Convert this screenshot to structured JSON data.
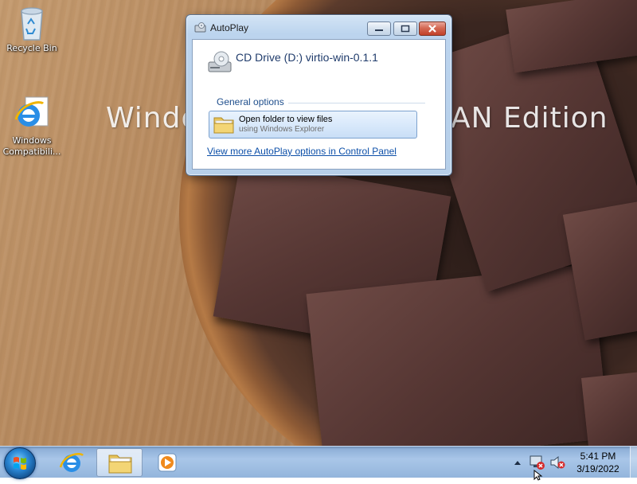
{
  "desktop": {
    "watermark": "Windows 7 ULTIMATE CRAPSTAN Edition",
    "watermark_left": "Windo",
    "watermark_right": "AN Edition",
    "icons": [
      {
        "label": "Recycle Bin",
        "icon": "recycle-bin-icon"
      },
      {
        "label": "Windows Compatibili...",
        "icon": "internet-explorer-icon"
      }
    ]
  },
  "autoplay": {
    "title": "AutoPlay",
    "drive_label": "CD Drive (D:) virtio-win-0.1.1",
    "section_label": "General options",
    "option": {
      "main": "Open folder to view files",
      "sub": "using Windows Explorer"
    },
    "more_link": "View more AutoPlay options in Control Panel"
  },
  "taskbar": {
    "buttons": [
      {
        "icon": "internet-explorer-icon"
      },
      {
        "icon": "windows-explorer-icon"
      },
      {
        "icon": "windows-media-player-icon"
      }
    ],
    "clock": {
      "time": "5:41 PM",
      "date": "3/19/2022"
    }
  },
  "colors": {
    "titlebar": "#bcd4ee",
    "link": "#0c4fa8",
    "section": "#1e4e8c",
    "taskbar": "#a9c6e8"
  }
}
